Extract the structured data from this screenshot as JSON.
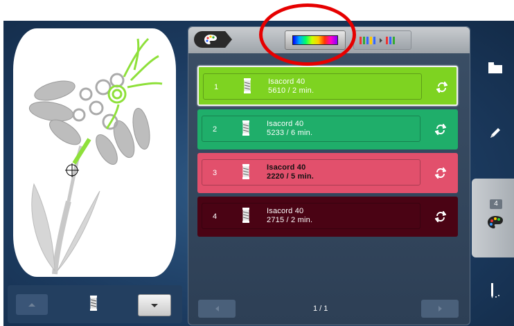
{
  "colors": {
    "row1": "#7ed321",
    "row2": "#1fae6a",
    "row3": "#e2506c",
    "row4": "#4a0314"
  },
  "threads": [
    {
      "index": "1",
      "brand": "Isacord 40",
      "details": "5610 / 2 min."
    },
    {
      "index": "2",
      "brand": "Isacord 40",
      "details": "5233 / 6 min."
    },
    {
      "index": "3",
      "brand": "Isacord 40",
      "details": "2220 / 5 min."
    },
    {
      "index": "4",
      "brand": "Isacord 40",
      "details": "2715 / 2 min."
    }
  ],
  "pager": {
    "text": "1 / 1"
  },
  "sidebar": {
    "color_count": "4"
  },
  "icons": [
    "palette-icon",
    "rainbow-icon",
    "sort-colors-icon",
    "spool-icon",
    "swap-icon",
    "folder-icon",
    "pencil-icon",
    "needle-icon",
    "arrow-up-icon",
    "arrow-down-icon"
  ]
}
